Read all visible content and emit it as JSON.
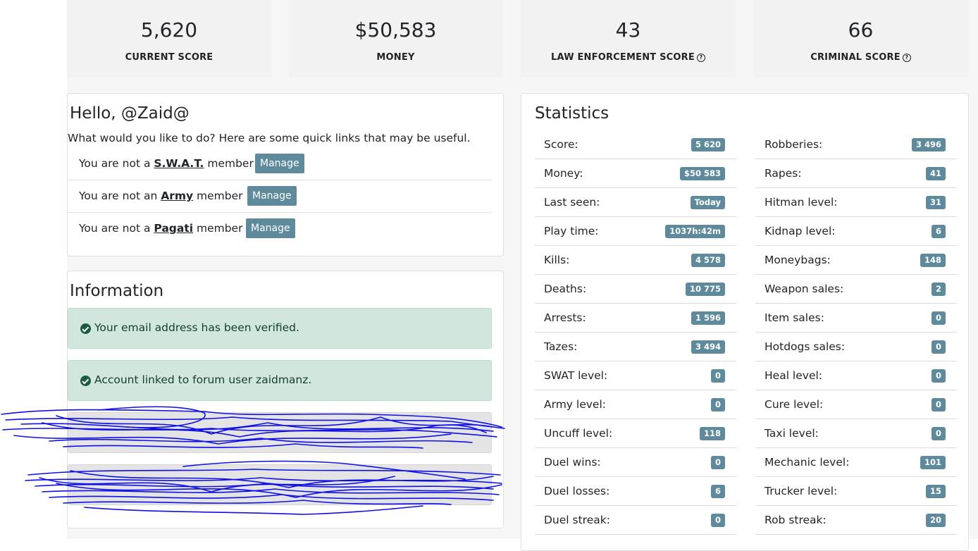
{
  "summary": [
    {
      "value": "5,620",
      "label": "CURRENT SCORE",
      "help": false
    },
    {
      "value": "$50,583",
      "label": "MONEY",
      "help": false
    },
    {
      "value": "43",
      "label": "LAW ENFORCEMENT SCORE",
      "help": true
    },
    {
      "value": "66",
      "label": "CRIMINAL SCORE",
      "help": true
    }
  ],
  "hello": {
    "title": "Hello, @Zaid@",
    "subtitle": "What would you like to do? Here are some quick links that may be useful.",
    "memberships": [
      {
        "prefix": "You are not a ",
        "org": "S.W.A.T.",
        "suffix": " member",
        "button": "Manage"
      },
      {
        "prefix": "You are not an ",
        "org": "Army",
        "suffix": " member",
        "button": "Manage"
      },
      {
        "prefix": "You are not a ",
        "org": "Pagati",
        "suffix": " member",
        "button": "Manage"
      }
    ]
  },
  "information": {
    "title": "Information",
    "alerts": [
      "Your email address has been verified.",
      "Account linked to forum user zaidmanz."
    ]
  },
  "statistics": {
    "title": "Statistics",
    "left": [
      {
        "label": "Score:",
        "value": "5 620"
      },
      {
        "label": "Money:",
        "value": "$50 583"
      },
      {
        "label": "Last seen:",
        "value": "Today"
      },
      {
        "label": "Play time:",
        "value": "1037h:42m"
      },
      {
        "label": "Kills:",
        "value": "4 578"
      },
      {
        "label": "Deaths:",
        "value": "10 775"
      },
      {
        "label": "Arrests:",
        "value": "1 596"
      },
      {
        "label": "Tazes:",
        "value": "3 494"
      },
      {
        "label": "SWAT level:",
        "value": "0"
      },
      {
        "label": "Army level:",
        "value": "0"
      },
      {
        "label": "Uncuff level:",
        "value": "118"
      },
      {
        "label": "Duel wins:",
        "value": "0"
      },
      {
        "label": "Duel losses:",
        "value": "6"
      },
      {
        "label": "Duel streak:",
        "value": "0"
      }
    ],
    "right": [
      {
        "label": "Robberies:",
        "value": "3 496"
      },
      {
        "label": "Rapes:",
        "value": "41"
      },
      {
        "label": "Hitman level:",
        "value": "31"
      },
      {
        "label": "Kidnap level:",
        "value": "6"
      },
      {
        "label": "Moneybags:",
        "value": "148"
      },
      {
        "label": "Weapon sales:",
        "value": "2"
      },
      {
        "label": "Item sales:",
        "value": "0"
      },
      {
        "label": "Hotdogs sales:",
        "value": "0"
      },
      {
        "label": "Heal level:",
        "value": "0"
      },
      {
        "label": "Cure level:",
        "value": "0"
      },
      {
        "label": "Taxi level:",
        "value": "0"
      },
      {
        "label": "Mechanic level:",
        "value": "101"
      },
      {
        "label": "Trucker level:",
        "value": "15"
      },
      {
        "label": "Rob streak:",
        "value": "20"
      }
    ]
  },
  "colors": {
    "badge": "#5e8a9b",
    "alert_bg": "#d1e7dd",
    "scribble": "#1010e6"
  }
}
